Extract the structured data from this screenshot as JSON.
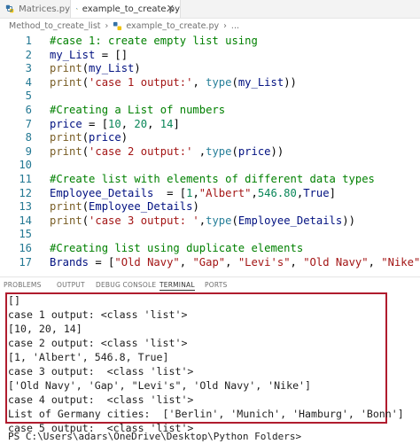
{
  "tabs": [
    {
      "label": "Matrices.py",
      "active": false
    },
    {
      "label": "example_to_create.py",
      "active": true
    }
  ],
  "breadcrumb": [
    "Method_to_create_list",
    "example_to_create.py"
  ],
  "code_lines": [
    {
      "n": "1",
      "parts": [
        {
          "t": "#case 1: create empty list using",
          "c": "cm"
        }
      ]
    },
    {
      "n": "2",
      "parts": [
        {
          "t": "my_List",
          "c": "var"
        },
        {
          "t": " = []",
          "c": ""
        }
      ]
    },
    {
      "n": "3",
      "parts": [
        {
          "t": "print",
          "c": "fn"
        },
        {
          "t": "(",
          "c": ""
        },
        {
          "t": "my_List",
          "c": "var"
        },
        {
          "t": ")",
          "c": ""
        }
      ]
    },
    {
      "n": "4",
      "parts": [
        {
          "t": "print",
          "c": "fn"
        },
        {
          "t": "(",
          "c": ""
        },
        {
          "t": "'case 1 output:'",
          "c": "str"
        },
        {
          "t": ", ",
          "c": ""
        },
        {
          "t": "type",
          "c": "cls"
        },
        {
          "t": "(",
          "c": ""
        },
        {
          "t": "my_List",
          "c": "var"
        },
        {
          "t": "))",
          "c": ""
        }
      ]
    },
    {
      "n": "5",
      "parts": []
    },
    {
      "n": "6",
      "parts": [
        {
          "t": "#Creating a List of numbers",
          "c": "cm"
        }
      ]
    },
    {
      "n": "7",
      "parts": [
        {
          "t": "price",
          "c": "var"
        },
        {
          "t": " = [",
          "c": ""
        },
        {
          "t": "10",
          "c": "num"
        },
        {
          "t": ", ",
          "c": ""
        },
        {
          "t": "20",
          "c": "num"
        },
        {
          "t": ", ",
          "c": ""
        },
        {
          "t": "14",
          "c": "num"
        },
        {
          "t": "]",
          "c": ""
        }
      ]
    },
    {
      "n": "8",
      "parts": [
        {
          "t": "print",
          "c": "fn"
        },
        {
          "t": "(",
          "c": ""
        },
        {
          "t": "price",
          "c": "var"
        },
        {
          "t": ")",
          "c": ""
        }
      ]
    },
    {
      "n": "9",
      "parts": [
        {
          "t": "print",
          "c": "fn"
        },
        {
          "t": "(",
          "c": ""
        },
        {
          "t": "'case 2 output:'",
          "c": "str"
        },
        {
          "t": " ,",
          "c": ""
        },
        {
          "t": "type",
          "c": "cls"
        },
        {
          "t": "(",
          "c": ""
        },
        {
          "t": "price",
          "c": "var"
        },
        {
          "t": "))",
          "c": ""
        }
      ]
    },
    {
      "n": "10",
      "parts": []
    },
    {
      "n": "11",
      "parts": [
        {
          "t": "#Create list with elements of different data types",
          "c": "cm"
        }
      ]
    },
    {
      "n": "12",
      "parts": [
        {
          "t": "Employee_Details",
          "c": "var"
        },
        {
          "t": "  = [",
          "c": ""
        },
        {
          "t": "1",
          "c": "num"
        },
        {
          "t": ",",
          "c": ""
        },
        {
          "t": "\"Albert\"",
          "c": "str"
        },
        {
          "t": ",",
          "c": ""
        },
        {
          "t": "546.80",
          "c": "num"
        },
        {
          "t": ",",
          "c": ""
        },
        {
          "t": "True",
          "c": "var"
        },
        {
          "t": "]",
          "c": ""
        }
      ]
    },
    {
      "n": "13",
      "parts": [
        {
          "t": "print",
          "c": "fn"
        },
        {
          "t": "(",
          "c": ""
        },
        {
          "t": "Employee_Details",
          "c": "var"
        },
        {
          "t": ")",
          "c": ""
        }
      ]
    },
    {
      "n": "14",
      "parts": [
        {
          "t": "print",
          "c": "fn"
        },
        {
          "t": "(",
          "c": ""
        },
        {
          "t": "'case 3 output: '",
          "c": "str"
        },
        {
          "t": ",",
          "c": ""
        },
        {
          "t": "type",
          "c": "cls"
        },
        {
          "t": "(",
          "c": ""
        },
        {
          "t": "Employee_Details",
          "c": "var"
        },
        {
          "t": "))",
          "c": ""
        }
      ]
    },
    {
      "n": "15",
      "parts": []
    },
    {
      "n": "16",
      "parts": [
        {
          "t": "#Creating list using duplicate elements",
          "c": "cm"
        }
      ]
    },
    {
      "n": "17",
      "parts": [
        {
          "t": "Brands",
          "c": "var"
        },
        {
          "t": " = [",
          "c": ""
        },
        {
          "t": "\"Old Navy\"",
          "c": "str"
        },
        {
          "t": ", ",
          "c": ""
        },
        {
          "t": "\"Gap\"",
          "c": "str"
        },
        {
          "t": ", ",
          "c": ""
        },
        {
          "t": "\"Levi's\"",
          "c": "str"
        },
        {
          "t": ", ",
          "c": ""
        },
        {
          "t": "\"Old Navy\"",
          "c": "str"
        },
        {
          "t": ", ",
          "c": ""
        },
        {
          "t": "\"Nike\"",
          "c": "str"
        },
        {
          "t": "]",
          "c": ""
        }
      ]
    }
  ],
  "panel_tabs": [
    {
      "label": "PROBLEMS",
      "active": false
    },
    {
      "label": "OUTPUT",
      "active": false
    },
    {
      "label": "DEBUG CONSOLE",
      "active": false
    },
    {
      "label": "TERMINAL",
      "active": true
    },
    {
      "label": "PORTS",
      "active": false
    }
  ],
  "terminal_lines": [
    "[]",
    "case 1 output: <class 'list'>",
    "[10, 20, 14]",
    "case 2 output: <class 'list'>",
    "[1, 'Albert', 546.8, True]",
    "case 3 output:  <class 'list'>",
    "['Old Navy', 'Gap', \"Levi's\", 'Old Navy', 'Nike']",
    "case 4 output:  <class 'list'>",
    "List of Germany cities:  ['Berlin', 'Munich', 'Hamburg', 'Bonn']",
    "case 5 output:  <class 'list'>",
    "PS C:\\Users\\adars\\OneDrive\\Desktop\\Python Folders>"
  ],
  "colors": {
    "highlight_box": "#b01c2e",
    "comment": "#008000",
    "string": "#a31515",
    "number": "#098658",
    "variable": "#001080",
    "function": "#795e26",
    "type": "#267f99",
    "line_number": "#237893"
  },
  "icons": {
    "python_file": "python-file-icon",
    "close": "close-icon"
  }
}
